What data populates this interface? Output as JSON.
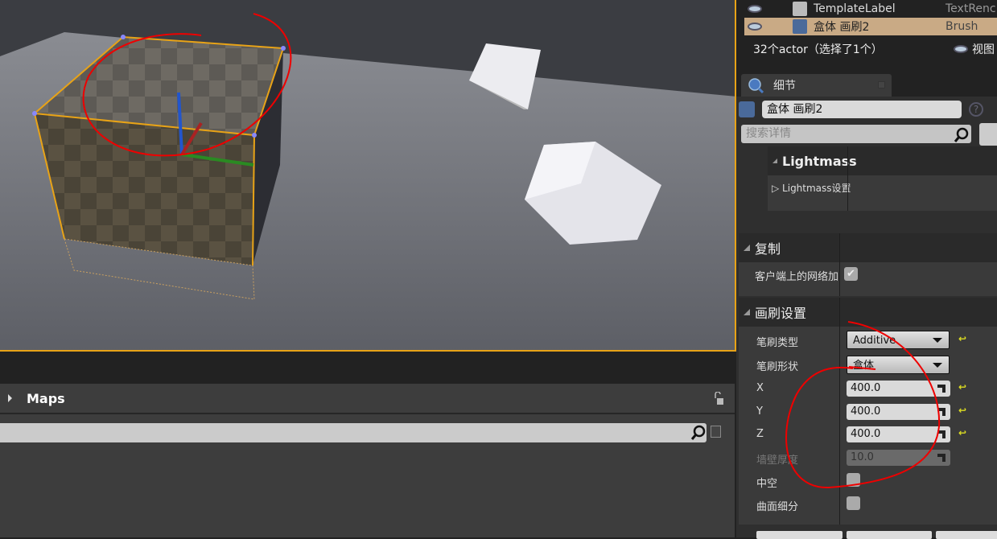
{
  "outliner": {
    "rows": [
      {
        "name": "TemplateLabel",
        "type": "TextRenc",
        "icon": "text-render-icon",
        "selected": false
      },
      {
        "name": "盒体 画刷2",
        "type": "Brush",
        "icon": "brush-icon",
        "selected": true
      }
    ],
    "count": "32个actor（选择了1个）",
    "view_options": "视图"
  },
  "details": {
    "tab_label": "细节",
    "actor_name": "盒体 画刷2",
    "search_placeholder": "搜索详情",
    "lightmass": {
      "header": "Lightmass",
      "row": "Lightmass设置"
    },
    "replication": {
      "header": "复制",
      "row": "客户端上的网络加",
      "checked": true
    },
    "brush_settings": {
      "header": "画刷设置",
      "brush_type_label": "笔刷类型",
      "brush_type": "Additive",
      "brush_shape_label": "笔刷形状",
      "brush_shape": "盒体",
      "x_label": "X",
      "x": "400.0",
      "y_label": "Y",
      "y": "400.0",
      "z_label": "Z",
      "z": "400.0",
      "wall_label": "墙壁厚度",
      "wall": "10.0",
      "hollow_label": "中空",
      "hollow": false,
      "tessellated_label": "曲面细分",
      "tessellated": false
    }
  },
  "content": {
    "maps_title": "Maps",
    "search_value": ""
  },
  "colors": {
    "selection": "#e8a317",
    "selected_row": "#c9aa85",
    "annotation": "#e00000"
  }
}
